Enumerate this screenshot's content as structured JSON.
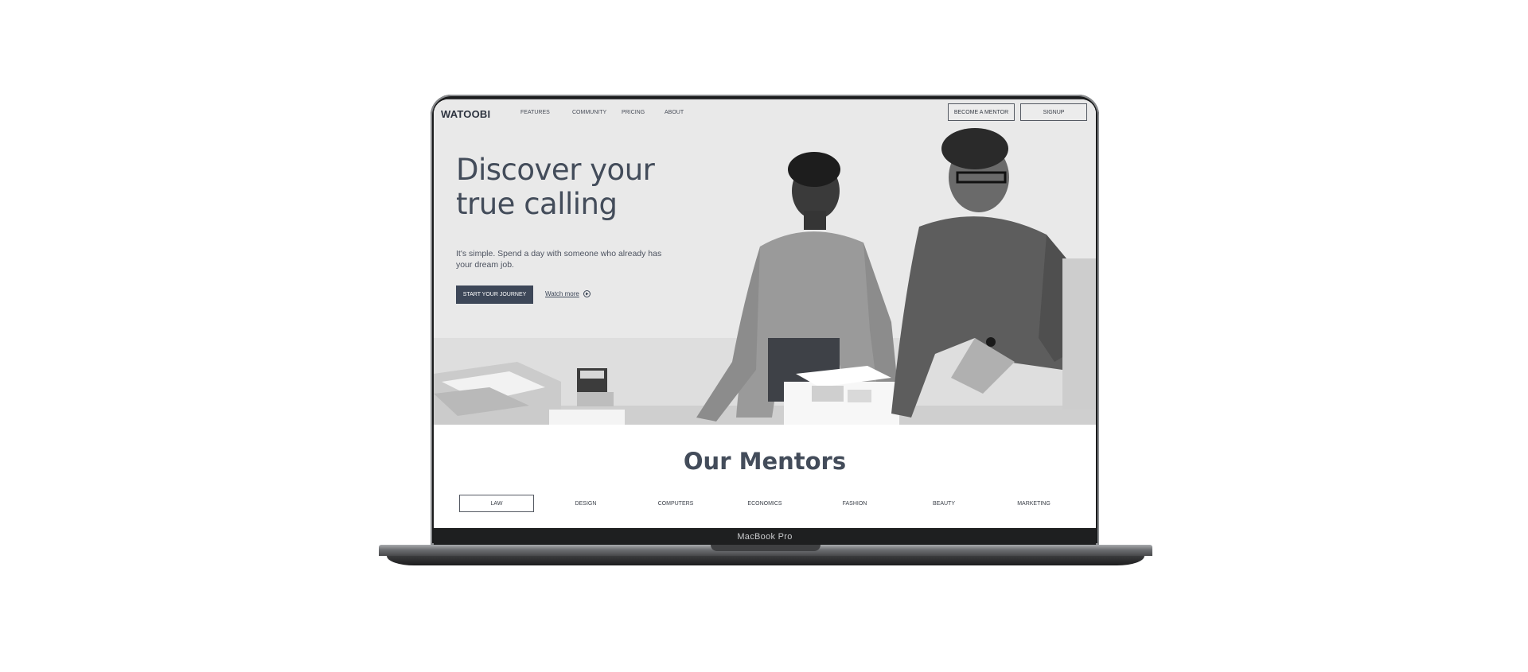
{
  "device": {
    "label": "MacBook Pro"
  },
  "nav": {
    "logo": "WATOOBI",
    "links": [
      "FEATURES",
      "COMMUNITY",
      "PRICING",
      "ABOUT"
    ],
    "become_mentor": "BECOME A MENTOR",
    "signup": "SIGNUP"
  },
  "hero": {
    "title": "Discover your true calling",
    "subtitle": "It's simple. Spend a day with someone who already has your dream job.",
    "cta": "START YOUR JOURNEY",
    "watch_more": "Watch more"
  },
  "mentors": {
    "title": "Our Mentors",
    "tabs": [
      "LAW",
      "DESIGN",
      "COMPUTERS",
      "ECONOMICS",
      "FASHION",
      "BEAUTY",
      "MARKETING"
    ],
    "active_tab": "LAW"
  },
  "colors": {
    "primary": "#3d4758",
    "heading": "#434c5a",
    "hero_bg": "#e8e8e8"
  },
  "icons": [
    "play-circle-icon"
  ]
}
